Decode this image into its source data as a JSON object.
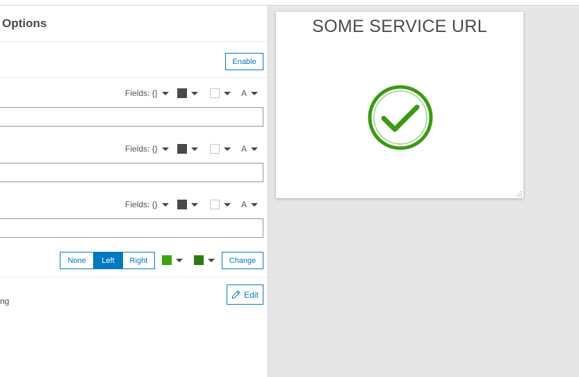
{
  "panel": {
    "title": "Options",
    "enable_label": "Enable",
    "text_rows": [
      {
        "fields_label": "Fields: {}",
        "text_color": "#4a4a4a",
        "bg_color": "#ffffff",
        "font_label": "A"
      },
      {
        "fields_label": "Fields: {}",
        "text_color": "#4a4a4a",
        "bg_color": "#ffffff",
        "font_label": "A"
      },
      {
        "fields_label": "Fields: {}",
        "text_color": "#4a4a4a",
        "bg_color": "#ffffff",
        "font_label": "A"
      }
    ],
    "alignment": {
      "options": [
        "None",
        "Left",
        "Right"
      ],
      "selected": "Left"
    },
    "icon_colors": {
      "primary": "#3aa30e",
      "secondary": "#2a7a10"
    },
    "change_label": "Change",
    "truncated_label": "ng",
    "edit_label": "Edit"
  },
  "preview": {
    "title": "SOME SERVICE URL",
    "icon": "checkmark-circle-icon",
    "icon_color": "#3a9a14"
  },
  "colors": {
    "accent": "#0079c1",
    "background": "#e6e6e6"
  }
}
